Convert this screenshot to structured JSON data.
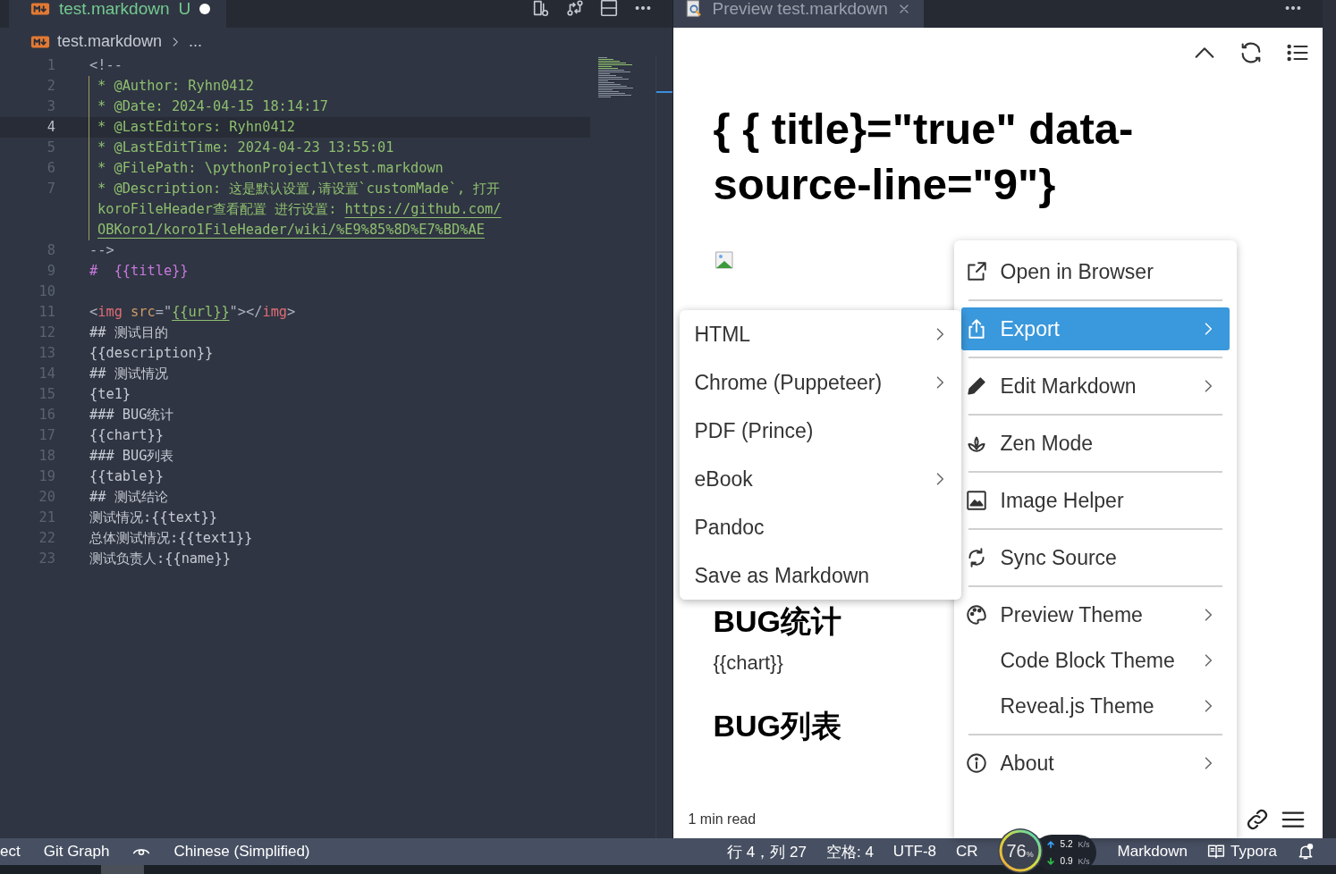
{
  "editor": {
    "tab": {
      "label": "test.markdown",
      "status": "U",
      "dirty": true,
      "selected": true
    },
    "breadcrumb": {
      "file": "test.markdown",
      "rest": "..."
    },
    "lines": [
      {
        "number": "1",
        "current": false,
        "guide": false,
        "rows": [
          [
            {
              "text": "<!--",
              "kind": "punct"
            }
          ]
        ]
      },
      {
        "number": "2",
        "current": false,
        "guide": true,
        "rows": [
          [
            {
              "text": "* @Author: Ryhn0412",
              "kind": "comment"
            }
          ]
        ]
      },
      {
        "number": "3",
        "current": false,
        "guide": true,
        "rows": [
          [
            {
              "text": "* @Date: 2024-04-15 18:14:17",
              "kind": "comment"
            }
          ]
        ]
      },
      {
        "number": "4",
        "current": true,
        "guide": true,
        "rows": [
          [
            {
              "text": "* @LastEditors: Ryhn0412",
              "kind": "comment"
            }
          ]
        ]
      },
      {
        "number": "5",
        "current": false,
        "guide": true,
        "rows": [
          [
            {
              "text": "* @LastEditTime: 2024-04-23 13:55:01",
              "kind": "comment"
            }
          ]
        ]
      },
      {
        "number": "6",
        "current": false,
        "guide": true,
        "rows": [
          [
            {
              "text": "* @FilePath: \\pythonProject1\\test.markdown",
              "kind": "comment"
            }
          ]
        ]
      },
      {
        "number": "7",
        "current": false,
        "guide": true,
        "rows": [
          [
            {
              "text": "* @Description: 这是默认设置,请设置`customMade`, 打开",
              "kind": "comment"
            }
          ],
          [
            {
              "text": "koroFileHeader查看配置 进行设置: ",
              "kind": "comment"
            },
            {
              "text": "https://github.com/",
              "kind": "link"
            }
          ],
          [
            {
              "text": "OBKoro1/koro1FileHeader/wiki/%E9%85%8D%E7%BD%AE",
              "kind": "link"
            }
          ]
        ]
      },
      {
        "number": "8",
        "current": false,
        "guide": false,
        "rows": [
          [
            {
              "text": "-->",
              "kind": "punct"
            }
          ]
        ]
      },
      {
        "number": "9",
        "current": false,
        "guide": false,
        "rows": [
          [
            {
              "text": "#  {{title}}",
              "kind": "heading"
            }
          ]
        ]
      },
      {
        "number": "10",
        "current": false,
        "guide": false,
        "rows": [
          []
        ]
      },
      {
        "number": "11",
        "current": false,
        "guide": false,
        "rows": [
          [
            {
              "text": "<",
              "kind": "punct"
            },
            {
              "text": "img",
              "kind": "tag"
            },
            {
              "text": " src",
              "kind": "attr"
            },
            {
              "text": "=\"",
              "kind": "punct"
            },
            {
              "text": "{{url}}",
              "kind": "link"
            },
            {
              "text": "\"></",
              "kind": "punct"
            },
            {
              "text": "img",
              "kind": "tag"
            },
            {
              "text": ">",
              "kind": "punct"
            }
          ]
        ]
      },
      {
        "number": "12",
        "current": false,
        "guide": false,
        "rows": [
          [
            {
              "text": "## 测试目的",
              "kind": "text"
            }
          ]
        ]
      },
      {
        "number": "13",
        "current": false,
        "guide": false,
        "rows": [
          [
            {
              "text": "{{description}}",
              "kind": "text"
            }
          ]
        ]
      },
      {
        "number": "14",
        "current": false,
        "guide": false,
        "rows": [
          [
            {
              "text": "## 测试情况",
              "kind": "text"
            }
          ]
        ]
      },
      {
        "number": "15",
        "current": false,
        "guide": false,
        "rows": [
          [
            {
              "text": "{te1}",
              "kind": "text"
            }
          ]
        ]
      },
      {
        "number": "16",
        "current": false,
        "guide": false,
        "rows": [
          [
            {
              "text": "### BUG统计",
              "kind": "text"
            }
          ]
        ]
      },
      {
        "number": "17",
        "current": false,
        "guide": false,
        "rows": [
          [
            {
              "text": "{{chart}}",
              "kind": "text"
            }
          ]
        ]
      },
      {
        "number": "18",
        "current": false,
        "guide": false,
        "rows": [
          [
            {
              "text": "### BUG列表",
              "kind": "text"
            }
          ]
        ]
      },
      {
        "number": "19",
        "current": false,
        "guide": false,
        "rows": [
          [
            {
              "text": "{{table}}",
              "kind": "text"
            }
          ]
        ]
      },
      {
        "number": "20",
        "current": false,
        "guide": false,
        "rows": [
          [
            {
              "text": "## 测试结论",
              "kind": "text"
            }
          ]
        ]
      },
      {
        "number": "21",
        "current": false,
        "guide": false,
        "rows": [
          [
            {
              "text": "测试情况:{{text}}",
              "kind": "text"
            }
          ]
        ]
      },
      {
        "number": "22",
        "current": false,
        "guide": false,
        "rows": [
          [
            {
              "text": "总体测试情况:{{text1}}",
              "kind": "text"
            }
          ]
        ]
      },
      {
        "number": "23",
        "current": false,
        "guide": false,
        "rows": [
          [
            {
              "text": "测试负责人:{{name}}",
              "kind": "text"
            }
          ]
        ]
      }
    ]
  },
  "preview": {
    "tab": {
      "label": "Preview test.markdown",
      "selected": false
    },
    "title": "{ { title}=\"true\" data-source-line=\"9\"}",
    "headings": [
      {
        "text": "BUG统计",
        "kind": "heading"
      },
      {
        "text": "{{chart}}",
        "kind": "paragraph"
      },
      {
        "text": "BUG列表",
        "kind": "heading"
      }
    ],
    "footer": "1 min read"
  },
  "context_menu": {
    "items": [
      {
        "label": "Open in Browser",
        "selected": false,
        "has_submenu": false,
        "separator_after": true
      },
      {
        "label": "Export",
        "selected": true,
        "has_submenu": true,
        "separator_after": true
      },
      {
        "label": "Edit Markdown",
        "selected": false,
        "has_submenu": true,
        "separator_after": true
      },
      {
        "label": "Zen Mode",
        "selected": false,
        "has_submenu": false,
        "separator_after": true
      },
      {
        "label": "Image Helper",
        "selected": false,
        "has_submenu": false,
        "separator_after": true
      },
      {
        "label": "Sync Source",
        "selected": false,
        "has_submenu": false,
        "separator_after": true
      },
      {
        "label": "Preview Theme",
        "selected": false,
        "has_submenu": true,
        "separator_after": false
      },
      {
        "label": "Code Block Theme",
        "selected": false,
        "has_submenu": true,
        "separator_after": false
      },
      {
        "label": "Reveal.js Theme",
        "selected": false,
        "has_submenu": true,
        "separator_after": true
      },
      {
        "label": "About",
        "selected": false,
        "has_submenu": true,
        "separator_after": false
      }
    ]
  },
  "export_submenu": {
    "items": [
      {
        "label": "HTML",
        "has_submenu": true
      },
      {
        "label": "Chrome (Puppeteer)",
        "has_submenu": true
      },
      {
        "label": "PDF (Prince)",
        "has_submenu": false
      },
      {
        "label": "eBook",
        "has_submenu": true
      },
      {
        "label": "Pandoc",
        "has_submenu": false
      },
      {
        "label": "Save as Markdown",
        "has_submenu": false
      }
    ]
  },
  "status_bar": {
    "left": [
      {
        "label": "ect",
        "kind": "text"
      },
      {
        "label": "Git Graph",
        "kind": "text"
      },
      {
        "kind": "eye"
      },
      {
        "label": "Chinese (Simplified)",
        "kind": "text"
      }
    ],
    "right": [
      {
        "label": "行 4，列 27",
        "kind": "text"
      },
      {
        "label": "空格: 4",
        "kind": "text"
      },
      {
        "label": "UTF-8",
        "kind": "text"
      },
      {
        "label": "CR",
        "kind": "text"
      },
      {
        "kind": "widget"
      },
      {
        "label": "Markdown",
        "kind": "text"
      },
      {
        "label": "Typora",
        "kind": "book"
      },
      {
        "kind": "bell"
      }
    ]
  },
  "network_widget": {
    "percent": "76",
    "unit": "%",
    "upload": "5.2",
    "upload_unit": "K/s",
    "download": "0.9",
    "download_unit": "K/s"
  }
}
